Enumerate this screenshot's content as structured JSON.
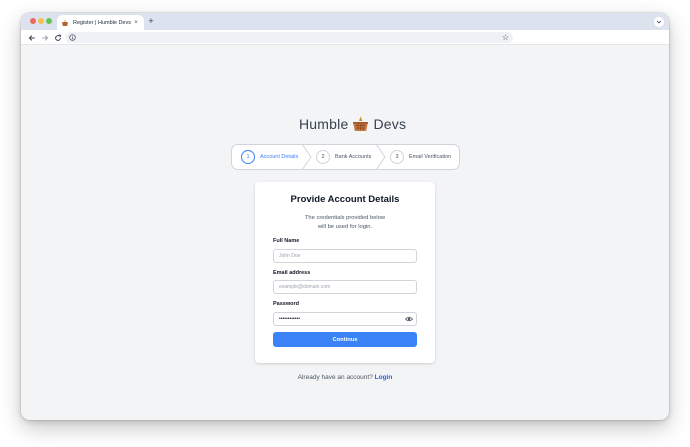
{
  "browser": {
    "tab_title": "Register | Humble Devs",
    "tab_close": "×",
    "new_tab": "+",
    "bookmark_star": "☆"
  },
  "brand": {
    "name_left": "Humble",
    "name_right": "Devs",
    "logo_icon": "basket-logo",
    "accent_color": "#3b82f6"
  },
  "steps": [
    {
      "number": "1",
      "label": "Account Details",
      "active": true
    },
    {
      "number": "2",
      "label": "Bank Accounts",
      "active": false
    },
    {
      "number": "3",
      "label": "Email Verification",
      "active": false
    }
  ],
  "form": {
    "title": "Provide Account Details",
    "subtitle_line1": "The credentials provided below",
    "subtitle_line2": "will be used for login.",
    "full_name_label": "Full Name",
    "full_name_placeholder": "John Doe",
    "email_label": "Email address",
    "email_placeholder": "example@domain.com",
    "password_label": "Password",
    "password_value": "••••••••••••",
    "submit_label": "Continue"
  },
  "footer": {
    "prompt": "Already have an account?",
    "login_link": "Login"
  }
}
